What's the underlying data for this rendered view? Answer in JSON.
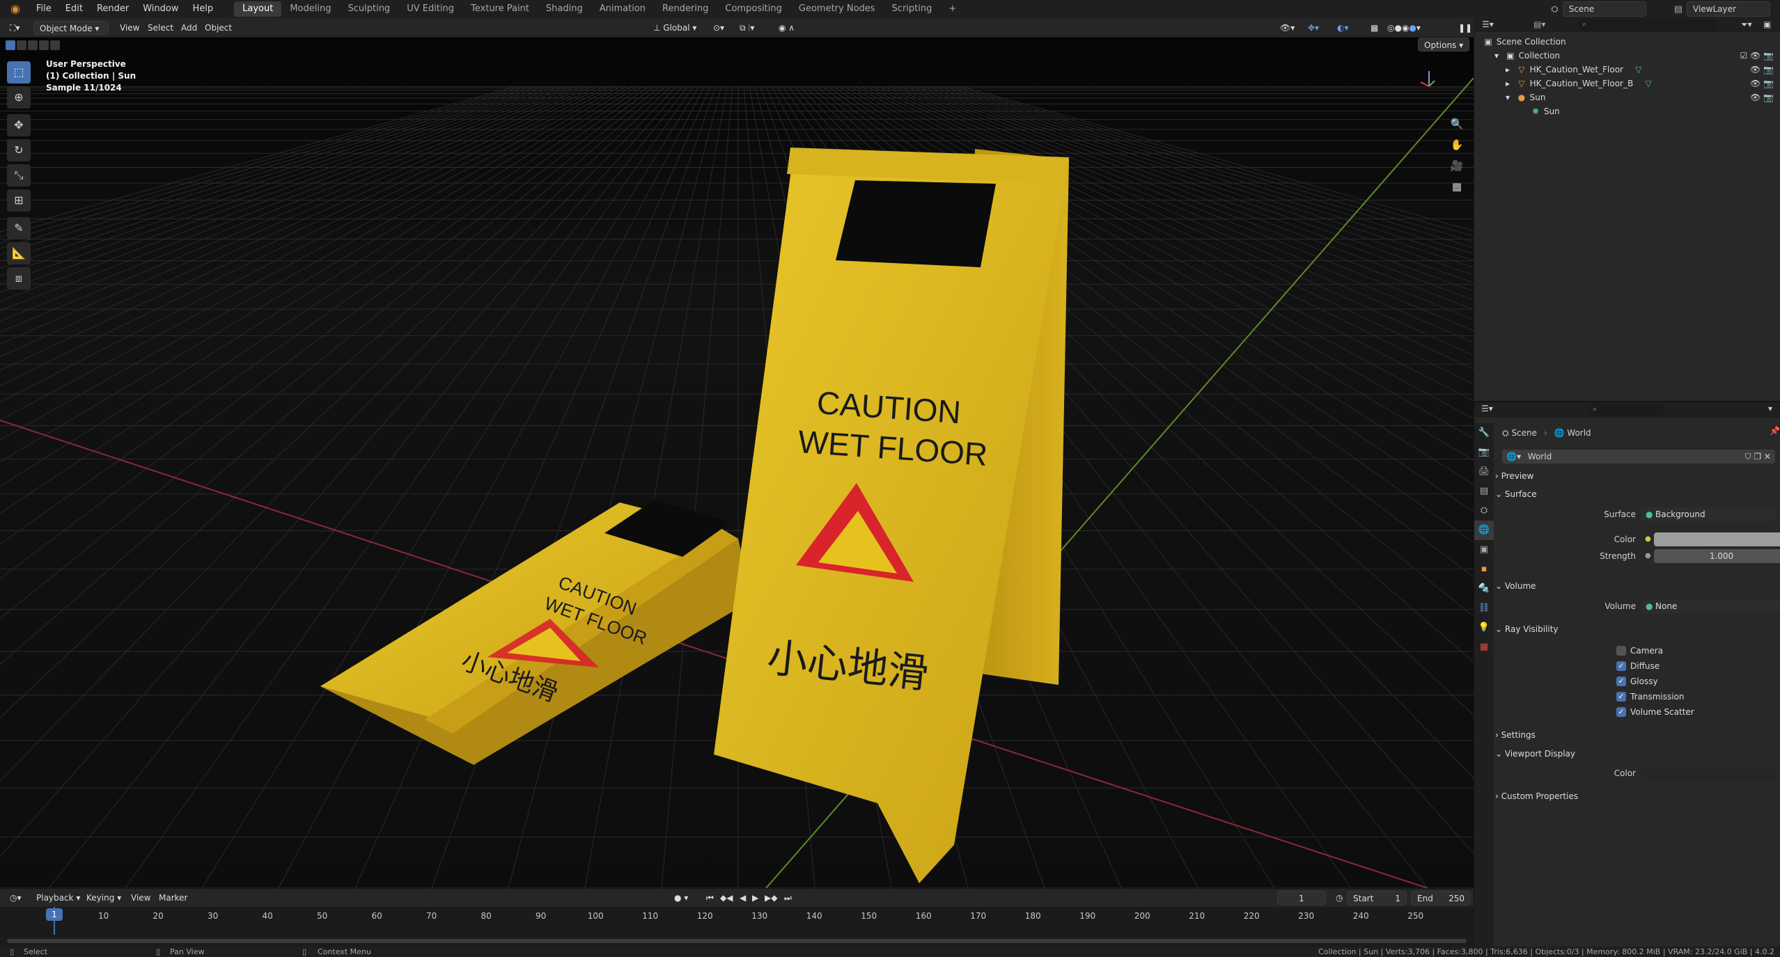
{
  "topbar": {
    "menus": [
      "File",
      "Edit",
      "Render",
      "Window",
      "Help"
    ],
    "workspaces": [
      "Layout",
      "Modeling",
      "Sculpting",
      "UV Editing",
      "Texture Paint",
      "Shading",
      "Animation",
      "Rendering",
      "Compositing",
      "Geometry Nodes",
      "Scripting"
    ],
    "active_workspace": "Layout",
    "scene_name": "Scene",
    "view_layer": "ViewLayer"
  },
  "viewport_header": {
    "mode": "Object Mode",
    "menus": [
      "View",
      "Select",
      "Add",
      "Object"
    ],
    "orientation": "Global",
    "options": "Options"
  },
  "viewport_overlay": {
    "line1": "User Perspective",
    "line2": "(1) Collection | Sun",
    "line3": "Sample 11/1024"
  },
  "scene_3d": {
    "sign_text_line1": "CAUTION",
    "sign_text_line2": "WET FLOOR",
    "sign_text_cn": "小心地滑",
    "sign_color": "#e6c21e",
    "warning_color": "#d8242a"
  },
  "timeline": {
    "menus": [
      "Playback",
      "Keying",
      "View",
      "Marker"
    ],
    "current_frame": "1",
    "start_label": "Start",
    "start": "1",
    "end_label": "End",
    "end": "250",
    "ticks": [
      "10",
      "20",
      "30",
      "40",
      "50",
      "60",
      "70",
      "80",
      "90",
      "100",
      "110",
      "120",
      "130",
      "140",
      "150",
      "160",
      "170",
      "180",
      "190",
      "200",
      "210",
      "220",
      "230",
      "240",
      "250"
    ],
    "playhead_label": "1"
  },
  "statusbar": {
    "left1": "Select",
    "left2": "Pan View",
    "left3": "Context Menu",
    "right": "Collection | Sun | Verts:3,706 | Faces:3,800 | Tris:6,636 | Objects:0/3 | Memory: 800.2 MiB | VRAM: 23.2/24.0 GiB | 4.0.2"
  },
  "outliner": {
    "root": "Scene Collection",
    "items": [
      {
        "label": "Collection"
      },
      {
        "label": "HK_Caution_Wet_Floor"
      },
      {
        "label": "HK_Caution_Wet_Floor_B"
      },
      {
        "label": "Sun"
      },
      {
        "label": "Sun"
      }
    ]
  },
  "properties": {
    "breadcrumb1": "Scene",
    "breadcrumb2": "World",
    "world_name": "World",
    "sections": {
      "preview": "Preview",
      "surface": "Surface",
      "volume": "Volume",
      "ray_visibility": "Ray Visibility",
      "settings": "Settings",
      "viewport_display": "Viewport Display",
      "custom_properties": "Custom Properties"
    },
    "surface_label": "Surface",
    "surface_value": "Background",
    "color_label": "Color",
    "strength_label": "Strength",
    "strength_value": "1.000",
    "volume_label": "Volume",
    "volume_value": "None",
    "ray": [
      {
        "label": "Camera",
        "checked": false
      },
      {
        "label": "Diffuse",
        "checked": true
      },
      {
        "label": "Glossy",
        "checked": true
      },
      {
        "label": "Transmission",
        "checked": true
      },
      {
        "label": "Volume Scatter",
        "checked": true
      }
    ],
    "vp_color_label": "Color"
  }
}
